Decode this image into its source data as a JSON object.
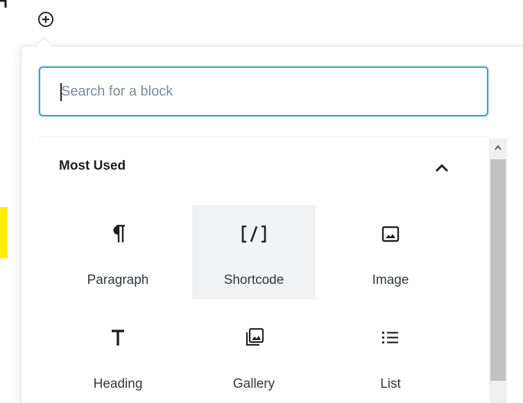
{
  "inserter": {
    "toggle_icon": "plus-circle-icon"
  },
  "search": {
    "placeholder": "Search for a block",
    "value": ""
  },
  "panel": {
    "title": "Most Used",
    "toggle_icon": "chevron-up-icon"
  },
  "blocks": [
    {
      "label": "Paragraph",
      "icon": "paragraph-icon"
    },
    {
      "label": "Shortcode",
      "icon": "shortcode-icon"
    },
    {
      "label": "Image",
      "icon": "image-icon"
    },
    {
      "label": "Heading",
      "icon": "heading-icon"
    },
    {
      "label": "Gallery",
      "icon": "gallery-icon"
    },
    {
      "label": "List",
      "icon": "list-icon"
    }
  ],
  "scrollbar": {
    "up_icon": "scroll-up-arrow-icon"
  },
  "colors": {
    "focus_border": "#33a0c4",
    "text": "#1e1e1e",
    "hover_bg": "#f1f2f3"
  }
}
